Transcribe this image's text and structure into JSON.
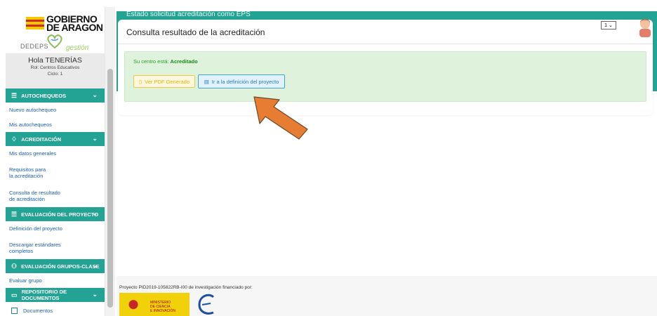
{
  "logo": {
    "gov_line1": "GOBIERNO",
    "gov_line2": "DE ARAGON",
    "dedeps": "DEDEPS",
    "gestion": "gestión"
  },
  "user": {
    "greeting": "Hola TENERÍAS",
    "role": "Rol: Centros Educativos",
    "cycle": "Ciclo: 1"
  },
  "sidebar": {
    "sections": [
      {
        "label": "AUTOCHEQUEOS",
        "items": [
          "Nuevo autochequeo",
          "Mis autochequeos"
        ]
      },
      {
        "label": "ACREDITACIÓN",
        "items": [
          "Mis datos generales",
          "Requisitos para",
          "la acreditación",
          "Consulta de resultado",
          "de acreditación"
        ]
      },
      {
        "label": "EVALUACIÓN DEL PROYECTO",
        "items": [
          "Definición del proyecto",
          "Descargar estándares",
          "completos"
        ]
      },
      {
        "label": "EVALUACIÓN GRUPOS-CLASE",
        "items": [
          "Evaluar grupo"
        ]
      },
      {
        "label": "REPOSITORIO DE DOCUMENTOS",
        "items": [
          "Documentos"
        ]
      }
    ]
  },
  "header": {
    "band_title": "Estado solicitud acreditación como EPS",
    "page_select": "1"
  },
  "card": {
    "title": "Consulta resultado de la acreditación",
    "status_prefix": "Su centro está:",
    "status_value": "Acreditado",
    "btn_pdf": "Ver PDF Generado",
    "btn_definition": "Ir a la definición del proyecto"
  },
  "footer": {
    "text": "Proyecto PID2019-105822RB-I00 de investigación financiado por:",
    "ministerio": [
      "MINISTERIO",
      "DE CIENCIA",
      "E INNOVACIÓN"
    ]
  },
  "colors": {
    "teal": "#23a393",
    "link": "#1a5fb4",
    "success_bg": "#dff2db",
    "arrow": "#e77c33"
  }
}
